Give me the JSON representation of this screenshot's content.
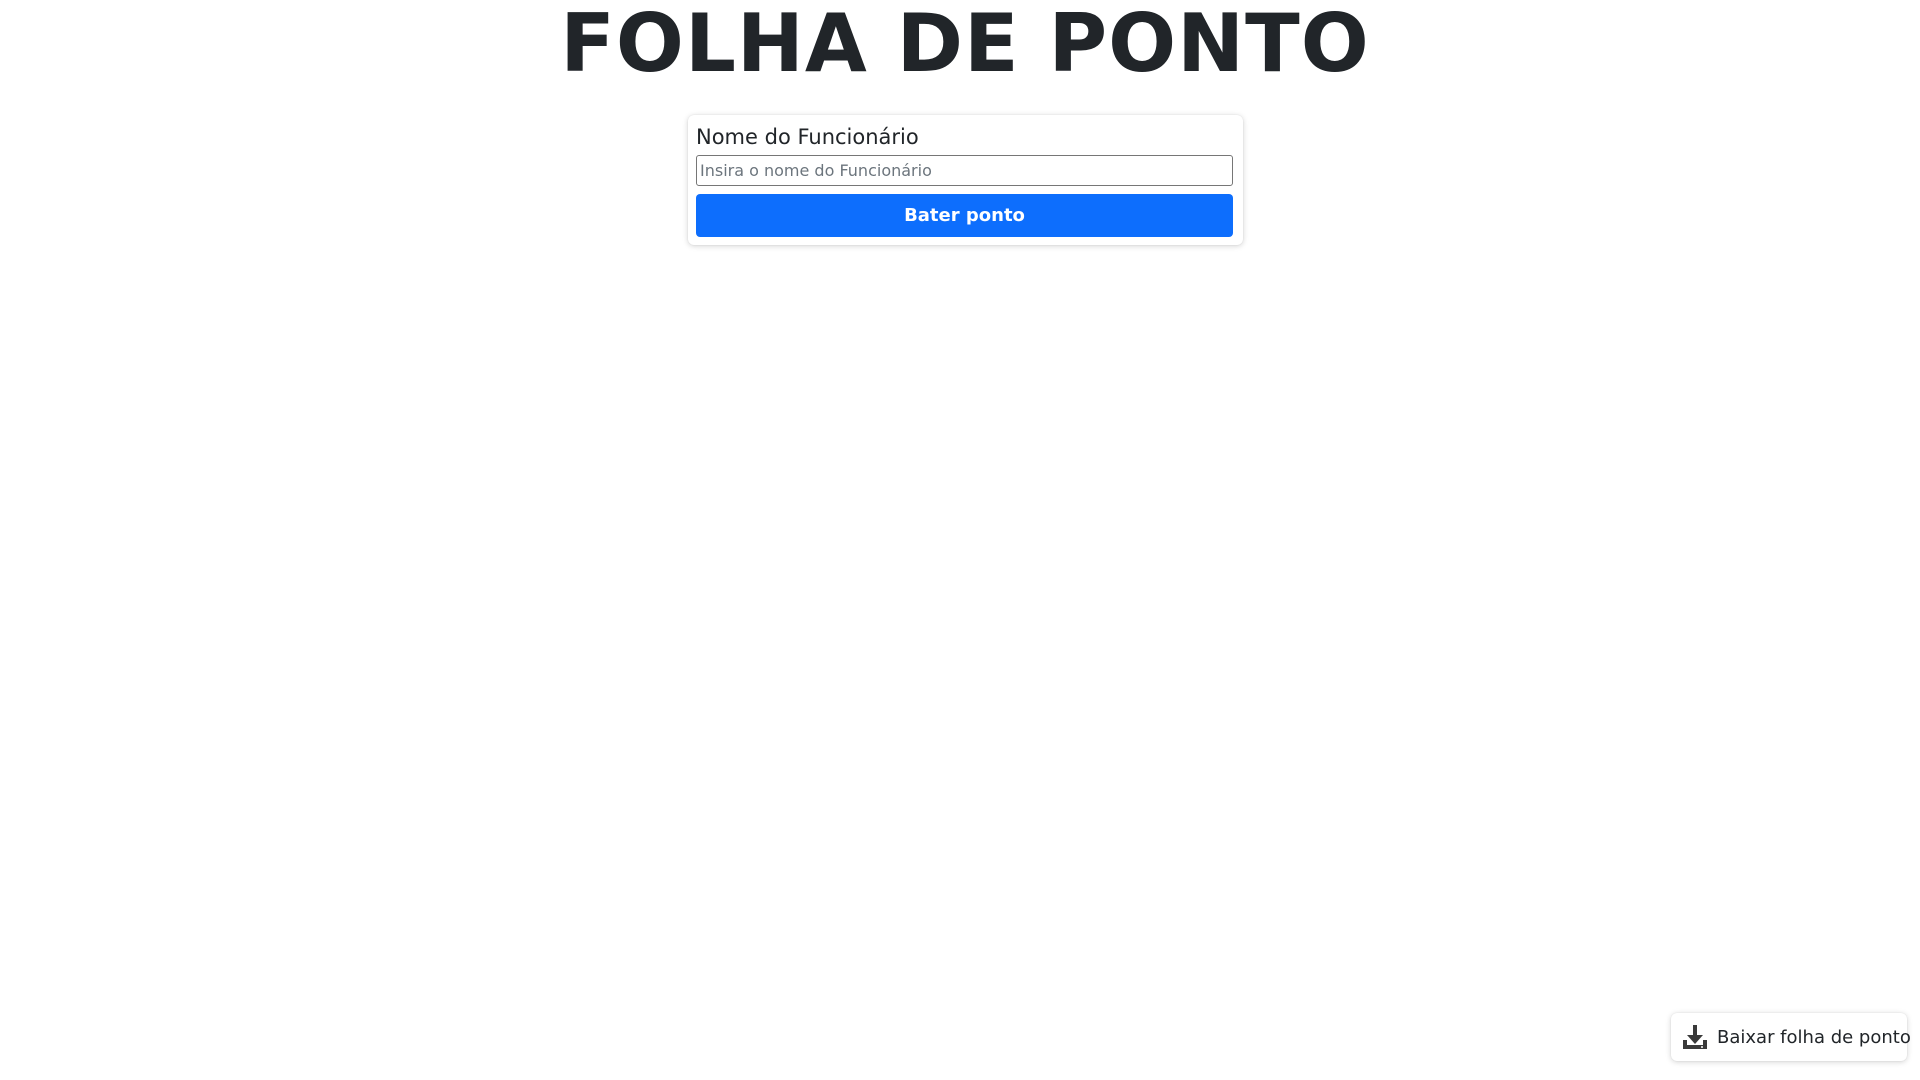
{
  "header": {
    "title": "FOLHA DE PONTO"
  },
  "form": {
    "name_label": "Nome do Funcionário",
    "name_input_value": "",
    "name_input_placeholder": "Insira o nome do Funcionário",
    "submit_label": "Bater ponto"
  },
  "download": {
    "label": "Baixar folha de ponto",
    "icon": "download-icon"
  },
  "colors": {
    "primary": "#0d6efd",
    "text": "#212529",
    "background": "#ffffff"
  }
}
